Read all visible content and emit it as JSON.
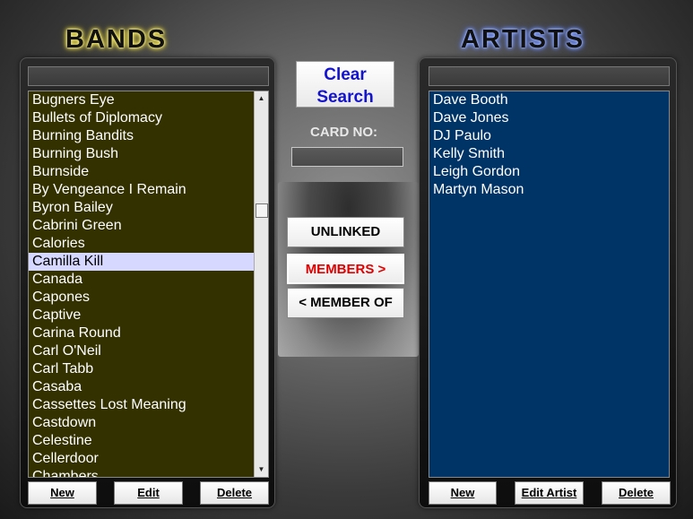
{
  "headings": {
    "bands": "BANDS",
    "artists": "ARTISTS"
  },
  "bands": {
    "search_value": "",
    "items": [
      "Bugners Eye",
      "Bullets of Diplomacy",
      "Burning Bandits",
      "Burning Bush",
      "Burnside",
      "By Vengeance I Remain",
      "Byron Bailey",
      "Cabrini Green",
      "Calories",
      "Camilla Kill",
      "Canada",
      "Capones",
      "Captive",
      "Carina Round",
      "Carl O'Neil",
      "Carl Tabb",
      "Casaba",
      "Cassettes Lost Meaning",
      "Castdown",
      "Celestine",
      "Cellerdoor",
      "Chambers"
    ],
    "selected_item": "Camilla Kill",
    "buttons": {
      "new": "New",
      "edit": "Edit",
      "delete": "Delete"
    }
  },
  "artists": {
    "search_value": "",
    "items": [
      "Dave Booth",
      "Dave Jones",
      "DJ Paulo",
      "Kelly Smith",
      "Leigh Gordon",
      "Martyn Mason"
    ],
    "buttons": {
      "new": "New",
      "edit": "Edit Artist",
      "delete": "Delete"
    }
  },
  "center": {
    "clear_search_line1": "Clear",
    "clear_search_line2": "Search",
    "card_no_label": "CARD NO:",
    "card_no_value": "",
    "unlinked": "UNLINKED",
    "members": "MEMBERS >",
    "member_of": "< MEMBER OF"
  },
  "colors": {
    "bands_list_bg": "#333100",
    "artists_list_bg": "#003366",
    "selected_bg": "#d6d8ff",
    "clear_search_text": "#1414d0",
    "members_text": "#e00000"
  },
  "icons": {
    "scroll_up": "scroll-up-arrow-icon",
    "scroll_down": "scroll-down-arrow-icon"
  }
}
